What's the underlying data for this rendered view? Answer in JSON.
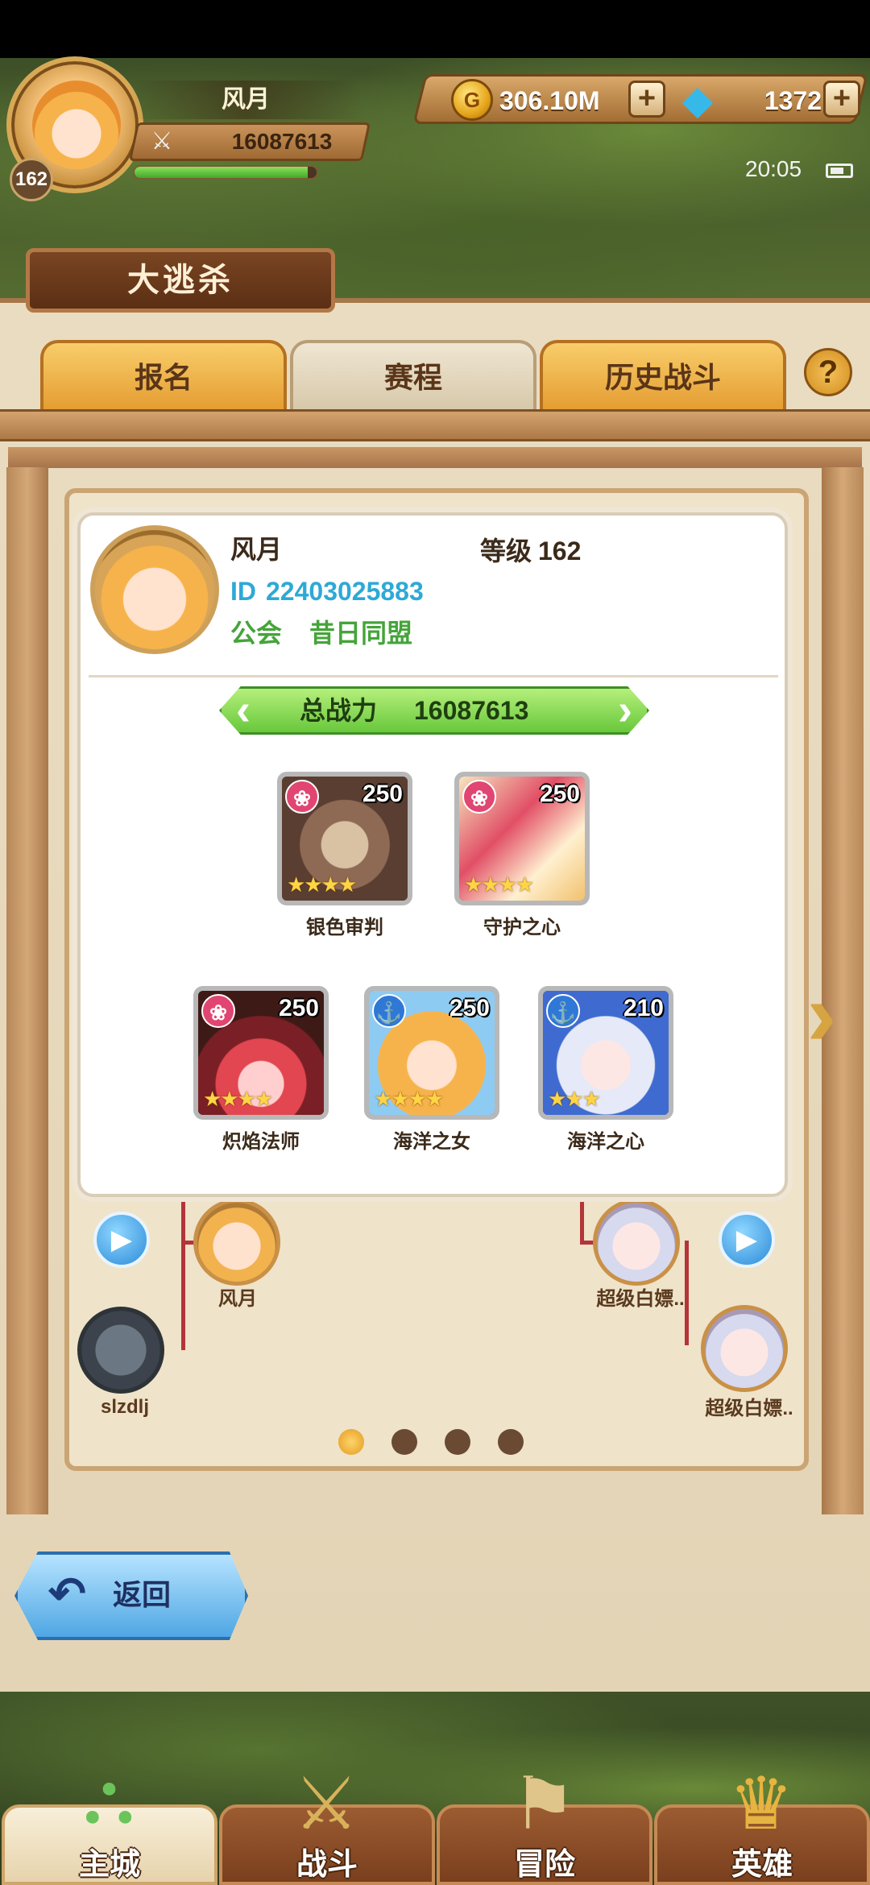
{
  "player": {
    "name": "风月",
    "level": "162",
    "power": "16087613",
    "xp_fraction": 0.95
  },
  "currency": {
    "gold": "306.10M",
    "gems": "1372",
    "plus": "+"
  },
  "status": {
    "time": "20:05"
  },
  "page": {
    "title": "大逃杀",
    "tabs": [
      {
        "label": "报名"
      },
      {
        "label": "赛程"
      },
      {
        "label": "历史战斗"
      }
    ],
    "help": "?"
  },
  "popup": {
    "name": "风月",
    "level_label": "等级",
    "level_value": "162",
    "id_label": "ID",
    "id_value": "22403025883",
    "guild_label": "公会",
    "guild_value": "昔日同盟",
    "power_label": "总战力",
    "power_value": "16087613",
    "heroes": [
      {
        "name": "银色审判",
        "level": "250",
        "stars": "★★★★",
        "badge": "❀",
        "faction": "red"
      },
      {
        "name": "守护之心",
        "level": "250",
        "stars": "★★★★",
        "badge": "❀",
        "faction": "red"
      },
      {
        "name": "炽焰法师",
        "level": "250",
        "stars": "★★★★",
        "badge": "❀",
        "faction": "red"
      },
      {
        "name": "海洋之女",
        "level": "250",
        "stars": "★★★★",
        "badge": "⚓",
        "faction": "blue"
      },
      {
        "name": "海洋之心",
        "level": "210",
        "stars": "★★★",
        "badge": "⚓",
        "faction": "blue"
      }
    ]
  },
  "bracket": {
    "left_top_name": "风月",
    "left_bottom_name": "slzdlj",
    "right_top_name": "超级白嫖..",
    "right_bottom_name": "超级白嫖.."
  },
  "back_button": {
    "label": "返回"
  },
  "nav": [
    {
      "label": "主城"
    },
    {
      "label": "战斗"
    },
    {
      "label": "冒险"
    },
    {
      "label": "英雄"
    }
  ],
  "colors": {
    "accent_tab": "#e49b2f",
    "id_blue": "#2ea9d6",
    "guild_green": "#45a43a",
    "power_green": "#68c83b"
  }
}
